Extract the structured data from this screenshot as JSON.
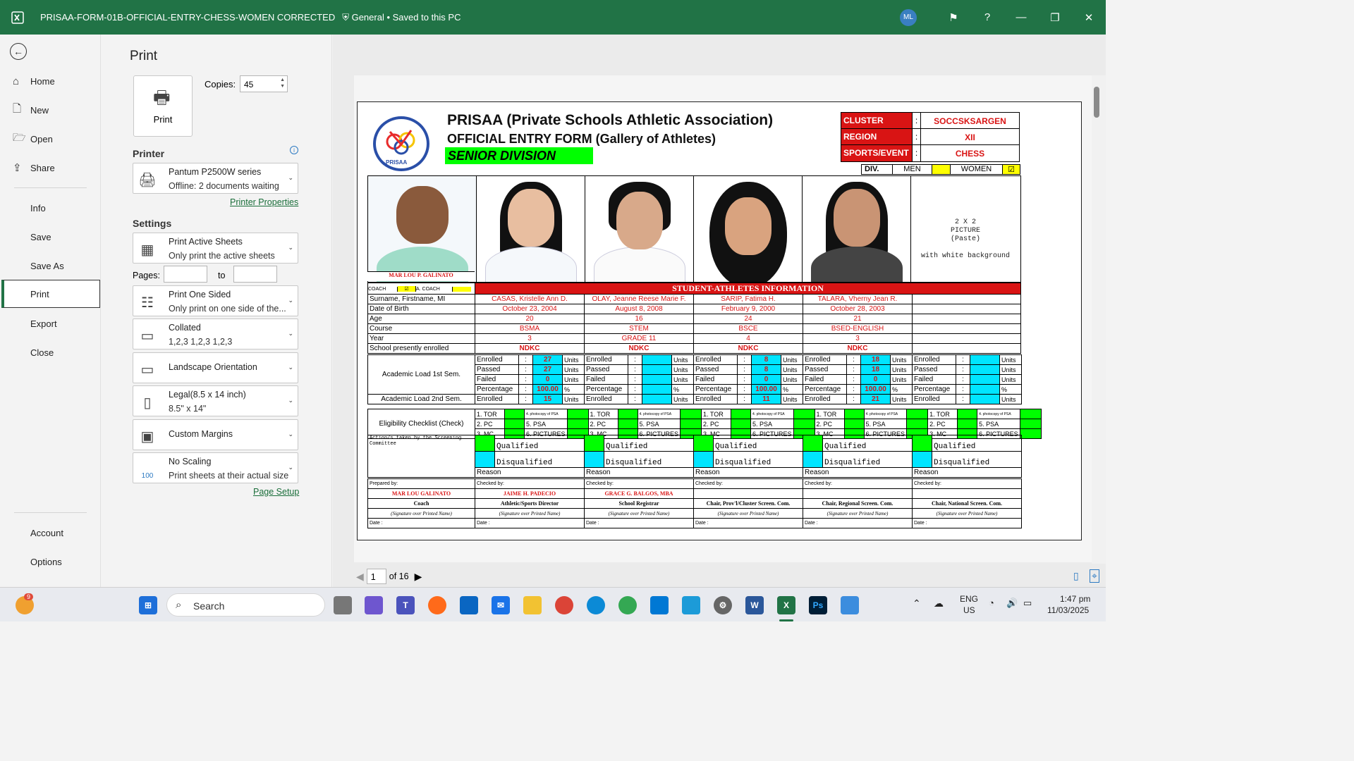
{
  "window": {
    "title": "PRISAA-FORM-01B-OFFICIAL-ENTRY-CHESS-WOMEN CORRECTED",
    "sensitivity": "General",
    "save_status": "Saved to this PC",
    "user_initials": "ML"
  },
  "nav": {
    "items": [
      {
        "label": "Home"
      },
      {
        "label": "New"
      },
      {
        "label": "Open"
      },
      {
        "label": "Share"
      },
      {
        "label": "Info"
      },
      {
        "label": "Save"
      },
      {
        "label": "Save As"
      },
      {
        "label": "Print"
      },
      {
        "label": "Export"
      },
      {
        "label": "Close"
      },
      {
        "label": "Account"
      },
      {
        "label": "Options"
      }
    ],
    "active": "Print"
  },
  "print": {
    "title": "Print",
    "print_button": "Print",
    "copies_label": "Copies:",
    "copies_value": "45",
    "printer_section": "Printer",
    "printer_name": "Pantum P2500W series",
    "printer_status": "Offline: 2 documents waiting",
    "printer_properties": "Printer Properties",
    "settings_section": "Settings",
    "sheets_l1": "Print Active Sheets",
    "sheets_l2": "Only print the active sheets",
    "pages_label": "Pages:",
    "to_label": "to",
    "sided_l1": "Print One Sided",
    "sided_l2": "Only print on one side of the...",
    "collate_l1": "Collated",
    "collate_l2": "1,2,3    1,2,3    1,2,3",
    "orientation": "Landscape Orientation",
    "paper_l1": "Legal(8.5 x 14 inch)",
    "paper_l2": "8.5\" x 14\"",
    "margins": "Custom Margins",
    "scaling_l1": "No Scaling",
    "scaling_l2": "Print sheets at their actual size",
    "scaling_icon_text": "100",
    "page_setup": "Page Setup"
  },
  "pager": {
    "current": "1",
    "of": "of 16"
  },
  "sheet": {
    "logo_text": "PRISAA",
    "title": "PRISAA (Private Schools Athletic Association)",
    "subtitle": "OFFICIAL ENTRY FORM (Gallery of Athletes)",
    "division_banner": "SENIOR DIVISION",
    "info": [
      {
        "key": "CLUSTER",
        "value": "SOCCSKSARGEN"
      },
      {
        "key": "REGION",
        "value": "XII"
      },
      {
        "key": "SPORTS/EVENT",
        "value": "CHESS"
      }
    ],
    "div_label": "DIV.",
    "men_label": "MEN",
    "women_label": "WOMEN",
    "picture_placeholder": [
      "2 X 2",
      "PICTURE",
      "(Paste)",
      "with white background"
    ],
    "coach_name": "MAR LOU P. GALINATO",
    "coach_label": "COACH",
    "acoach_label": "A. COACH",
    "section_header": "STUDENT-ATHLETES INFORMATION",
    "row_labels": [
      "Surname, Firstname, MI",
      "Date of Birth",
      "Age",
      "Course",
      "Year",
      "School presently enrolled"
    ],
    "athletes": [
      {
        "name": "CASAS, Kristelle Ann D.",
        "dob": "October 23, 2004",
        "age": "20",
        "course": "BSMA",
        "year": "3",
        "school": "NDKC",
        "s1_enrolled": "27",
        "s1_passed": "27",
        "s1_failed": "0",
        "s1_pct": "100.00",
        "s2_enrolled": "15"
      },
      {
        "name": "OLAY, Jeanne Reese Marie F.",
        "dob": "August 8, 2008",
        "age": "16",
        "course": "STEM",
        "year": "GRADE 11",
        "school": "NDKC",
        "s1_enrolled": "",
        "s1_passed": "",
        "s1_failed": "",
        "s1_pct": "",
        "s2_enrolled": ""
      },
      {
        "name": "SARIP, Fatima H.",
        "dob": "February 9, 2000",
        "age": "24",
        "course": "BSCE",
        "year": "4",
        "school": "NDKC",
        "s1_enrolled": "8",
        "s1_passed": "8",
        "s1_failed": "0",
        "s1_pct": "100.00",
        "s2_enrolled": "11"
      },
      {
        "name": "TALARA, Vherny Jean R.",
        "dob": "October 28, 2003",
        "age": "21",
        "course": "BSED-ENGLISH",
        "year": "3",
        "school": "NDKC",
        "s1_enrolled": "18",
        "s1_passed": "18",
        "s1_failed": "0",
        "s1_pct": "100.00",
        "s2_enrolled": "21"
      },
      {
        "name": "",
        "dob": "",
        "age": "",
        "course": "",
        "year": "",
        "school": "",
        "s1_enrolled": "",
        "s1_passed": "",
        "s1_failed": "",
        "s1_pct": "",
        "s2_enrolled": ""
      }
    ],
    "academic_1st": "Academic Load 1st Sem.",
    "academic_2nd": "Academic Load 2nd Sem.",
    "load_labels": {
      "enrolled": "Enrolled",
      "passed": "Passed",
      "failed": "Failed",
      "percentage": "Percentage",
      "units": "Units",
      "pct": "%",
      "colon": ":"
    },
    "eligibility_label": "Eligibility Checklist (Check)",
    "elig_items": {
      "tor": "1. TOR",
      "psa_copy": "4. photocopy of PSA",
      "pc": "2. PC",
      "psa": "5. PSA",
      "mc": "3. MC",
      "pictures": "6. PICTURES"
    },
    "action_label": "Action/s taken by the Screening Committee",
    "qualified": "Qualified",
    "disqualified": "Disqualified",
    "reason": "Reason",
    "prepared_by": "Prepared by:",
    "checked_by": "Checked by:",
    "signatories": [
      {
        "name": "MAR LOU GALINATO",
        "role": "Coach"
      },
      {
        "name": "JAIME H. PADECIO",
        "role": "Athletic/Sports Director"
      },
      {
        "name": "GRACE G. BALGOS, MBA",
        "role": "School Registrar"
      },
      {
        "name": "",
        "role": "Chair, Prov'l/Cluster Screen. Com."
      },
      {
        "name": "",
        "role": "Chair, Regional Screen. Com."
      },
      {
        "name": "",
        "role": "Chair, National Screen. Com."
      }
    ],
    "sig_caption": "(Signature over Printed Name)",
    "date_label": "Date :"
  },
  "taskbar": {
    "search": "Search",
    "notification_count": "9",
    "lang": "ENG",
    "region": "US",
    "time": "1:47 pm",
    "date": "11/03/2025"
  },
  "colors": {
    "excel_green": "#217346",
    "accent_red": "#d91414",
    "cyan": "#00e5ff",
    "lime": "#00ff00"
  }
}
